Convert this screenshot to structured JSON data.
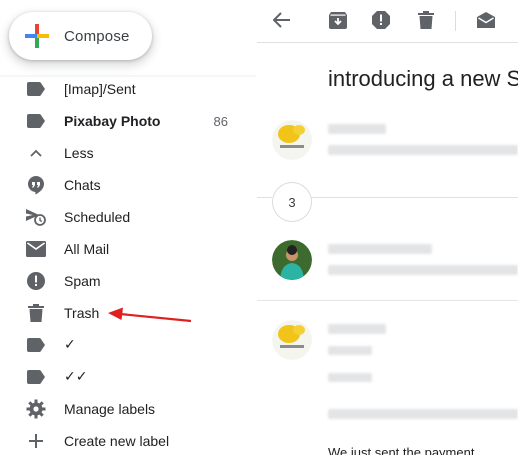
{
  "compose": {
    "label": "Compose"
  },
  "labels": [
    {
      "key": "imap_sent",
      "label": "[Imap]/Sent",
      "icon": "label-icon",
      "count": "",
      "bold": false
    },
    {
      "key": "pixabay",
      "label": "Pixabay Photo",
      "icon": "label-icon",
      "count": "86",
      "bold": true
    },
    {
      "key": "less",
      "label": "Less",
      "icon": "chevron-up-icon",
      "count": "",
      "bold": false
    },
    {
      "key": "chats",
      "label": "Chats",
      "icon": "chat-icon",
      "count": "",
      "bold": false
    },
    {
      "key": "scheduled",
      "label": "Scheduled",
      "icon": "scheduled-icon",
      "count": "",
      "bold": false
    },
    {
      "key": "all_mail",
      "label": "All Mail",
      "icon": "mail-icon",
      "count": "",
      "bold": false
    },
    {
      "key": "spam",
      "label": "Spam",
      "icon": "spam-icon",
      "count": "",
      "bold": false
    },
    {
      "key": "trash",
      "label": "Trash",
      "icon": "trash-icon",
      "count": "",
      "bold": false
    },
    {
      "key": "check1",
      "label": "✓",
      "icon": "label-icon",
      "count": "",
      "bold": false
    },
    {
      "key": "check2",
      "label": "✓✓",
      "icon": "label-icon",
      "count": "",
      "bold": false
    },
    {
      "key": "manage",
      "label": "Manage labels",
      "icon": "gear-icon",
      "count": "",
      "bold": false
    },
    {
      "key": "create",
      "label": "Create new label",
      "icon": "plus-icon",
      "count": "",
      "bold": false
    }
  ],
  "thread": {
    "subject": "introducing a new S",
    "collapsed_count": "3",
    "body_line": "We just sent the payment"
  },
  "colors": {
    "icon_gray": "#5f6368",
    "annotation_red": "#e02020",
    "plus_blue": "#4285f4",
    "plus_red": "#ea4335",
    "plus_yellow": "#fbbc04",
    "plus_green": "#34a853"
  }
}
